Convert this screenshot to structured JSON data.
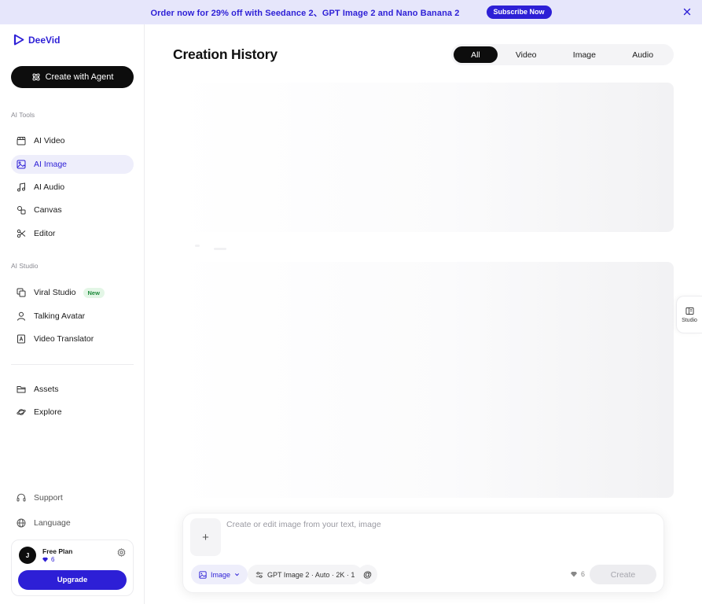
{
  "banner": {
    "text": "Order now for 29% off with Seedance 2、GPT Image 2 and Nano Banana 2",
    "cta": "Subscribe Now"
  },
  "brand": {
    "name": "DeeVid",
    "accent": "#2d1fd6"
  },
  "sidebar": {
    "agent_button": "Create with Agent",
    "ai_tools_label": "AI Tools",
    "ai_tools": [
      {
        "label": "AI Video",
        "icon": "clapperboard-icon"
      },
      {
        "label": "AI Image",
        "icon": "image-icon",
        "active": true
      },
      {
        "label": "AI Audio",
        "icon": "music-icon"
      },
      {
        "label": "Canvas",
        "icon": "shapes-icon"
      },
      {
        "label": "Editor",
        "icon": "scissors-icon"
      }
    ],
    "ai_studio_label": "AI Studio",
    "ai_studio": [
      {
        "label": "Viral Studio",
        "icon": "copy-icon",
        "badge": "New"
      },
      {
        "label": "Talking Avatar",
        "icon": "user-icon"
      },
      {
        "label": "Video Translator",
        "icon": "translate-icon"
      }
    ],
    "library": [
      {
        "label": "Assets",
        "icon": "folder-icon"
      },
      {
        "label": "Explore",
        "icon": "planet-icon"
      }
    ],
    "footer": [
      {
        "label": "Support",
        "icon": "headset-icon"
      },
      {
        "label": "Language",
        "icon": "globe-icon"
      }
    ],
    "plan": {
      "avatar_initial": "J",
      "name": "Free Plan",
      "credits": "6",
      "upgrade": "Upgrade"
    }
  },
  "main": {
    "title": "Creation History",
    "tabs": [
      "All",
      "Video",
      "Image",
      "Audio"
    ],
    "active_tab": "All"
  },
  "studio_panel": {
    "label": "Studio"
  },
  "composer": {
    "placeholder": "Create or edit image from your text, image",
    "upload": "+",
    "mode": "Image",
    "model": "GPT Image 2 · Auto · 2K · 1",
    "mention": "@",
    "cost": "6",
    "create": "Create"
  }
}
